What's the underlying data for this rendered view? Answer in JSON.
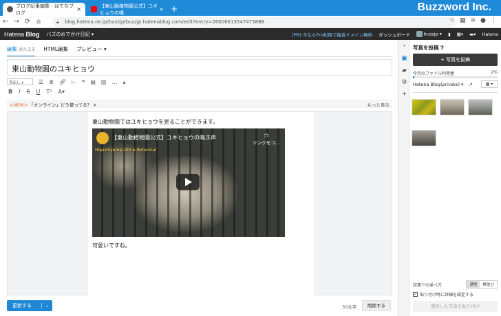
{
  "browser": {
    "brand": "Buzzword Inc.",
    "tabs": [
      {
        "label": "ブログ記事編集 - はてなブログ",
        "active": true
      },
      {
        "label": "【東山動植物園公式】ユキヒョウの鳴",
        "active": false
      }
    ],
    "new_tab": "+",
    "url": "blog.hatena.ne.jp/buzzjp/buzzjp.hatenablog.com/edit?entry=26006613547473888"
  },
  "header": {
    "logo_prefix": "Hatena",
    "logo_suffix": "Blog",
    "blog_name": "バズのおでかけ日記",
    "promo": "[PR] 今ならPro利用で独自ドメイン無料",
    "dashboard": "ダッシュボード",
    "user": "buzzjp",
    "hatena": "Hatena"
  },
  "editor": {
    "tabs": [
      {
        "label": "編集",
        "sub": "見たまま",
        "active": true
      },
      {
        "label": "HTML編集",
        "sub": "",
        "active": false
      },
      {
        "label": "プレビュー",
        "sub": "",
        "active": false
      }
    ],
    "title": "東山動物園のユキヒョウ",
    "format_select": "見出し",
    "news_tag": "<NEW>",
    "news_text": "「オンライン」どう使ってる？ ×",
    "news_more": "もっと見る",
    "paragraph1": "東山動物園ではユキヒョウを見ることができます。",
    "video": {
      "title": "【東山動植物園公式】ユキヒョウの鳴き声",
      "copy_label": "リンクをコ...",
      "side_text": "Higashiyama 100 & Botanical"
    },
    "paragraph2": "可愛いですね。",
    "save_button": "更新する",
    "char_count": "30文字",
    "delete_button": "削除する"
  },
  "panel": {
    "title": "写真を投稿",
    "post_button": "+ 写真を投稿",
    "usage_label": "今月のファイル利用量",
    "usage_percent": "2%",
    "usage_fraction": 0.02,
    "album": "Hatena Blog(private)",
    "sort_label": "記事での並べ方",
    "sort_options": [
      "通常",
      "横並び"
    ],
    "checkbox_label": "貼り付け時に詳細を設定する",
    "paste_button": "選択した写真を貼り付け"
  }
}
